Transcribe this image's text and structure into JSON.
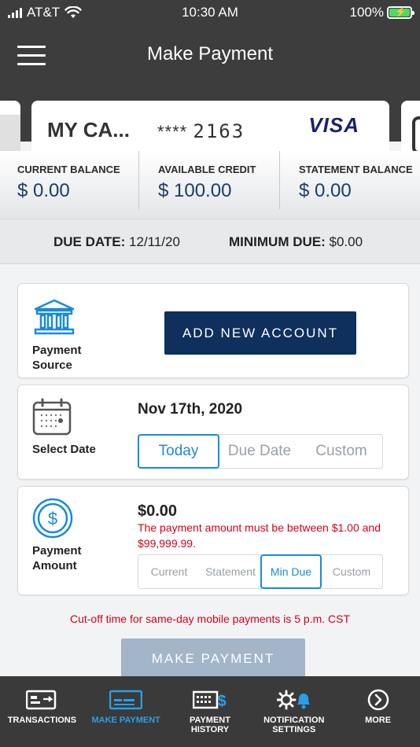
{
  "status_bar": {
    "carrier": "AT&T",
    "time": "10:30 AM",
    "battery": "100%"
  },
  "header": {
    "title": "Make Payment"
  },
  "card": {
    "name": "MY CA...",
    "mask": "****",
    "last4": "2163",
    "brand": "VISA"
  },
  "balances": [
    {
      "label": "CURRENT BALANCE",
      "value": "$ 0.00"
    },
    {
      "label": "AVAILABLE CREDIT",
      "value": "$ 100.00"
    },
    {
      "label": "STATEMENT BALANCE",
      "value": "$ 0.00"
    }
  ],
  "due": {
    "due_date_label": "DUE DATE:",
    "due_date": "12/11/20",
    "min_due_label": "MINIMUM DUE:",
    "min_due": "$0.00"
  },
  "payment_source": {
    "label_line1": "Payment",
    "label_line2": "Source",
    "button": "ADD NEW ACCOUNT"
  },
  "select_date": {
    "label": "Select Date",
    "selected_date": "Nov 17th, 2020",
    "options": [
      "Today",
      "Due Date",
      "Custom"
    ]
  },
  "payment_amount": {
    "label_line1": "Payment",
    "label_line2": "Amount",
    "value": "$0.00",
    "error": "The payment amount must be between $1.00 and $99,999.99.",
    "options": [
      "Current",
      "Statement",
      "Min Due",
      "Custom"
    ]
  },
  "cutoff_notice": "Cut-off time for same-day mobile payments is 5 p.m. CST",
  "make_payment_button": "MAKE PAYMENT",
  "tabbar": [
    {
      "label": "TRANSACTIONS",
      "active": false
    },
    {
      "label": "MAKE PAYMENT",
      "active": true
    },
    {
      "label_line1": "PAYMENT",
      "label_line2": "HISTORY",
      "active": false
    },
    {
      "label_line1": "NOTIFICATION",
      "label_line2": "SETTINGS",
      "active": false
    },
    {
      "label": "MORE",
      "active": false
    }
  ],
  "colors": {
    "header": "#3d3d3d",
    "navy": "#0f2f5c",
    "accent": "#1a8ad8",
    "error": "#d0021b",
    "balance_value": "#1b3c6e"
  }
}
